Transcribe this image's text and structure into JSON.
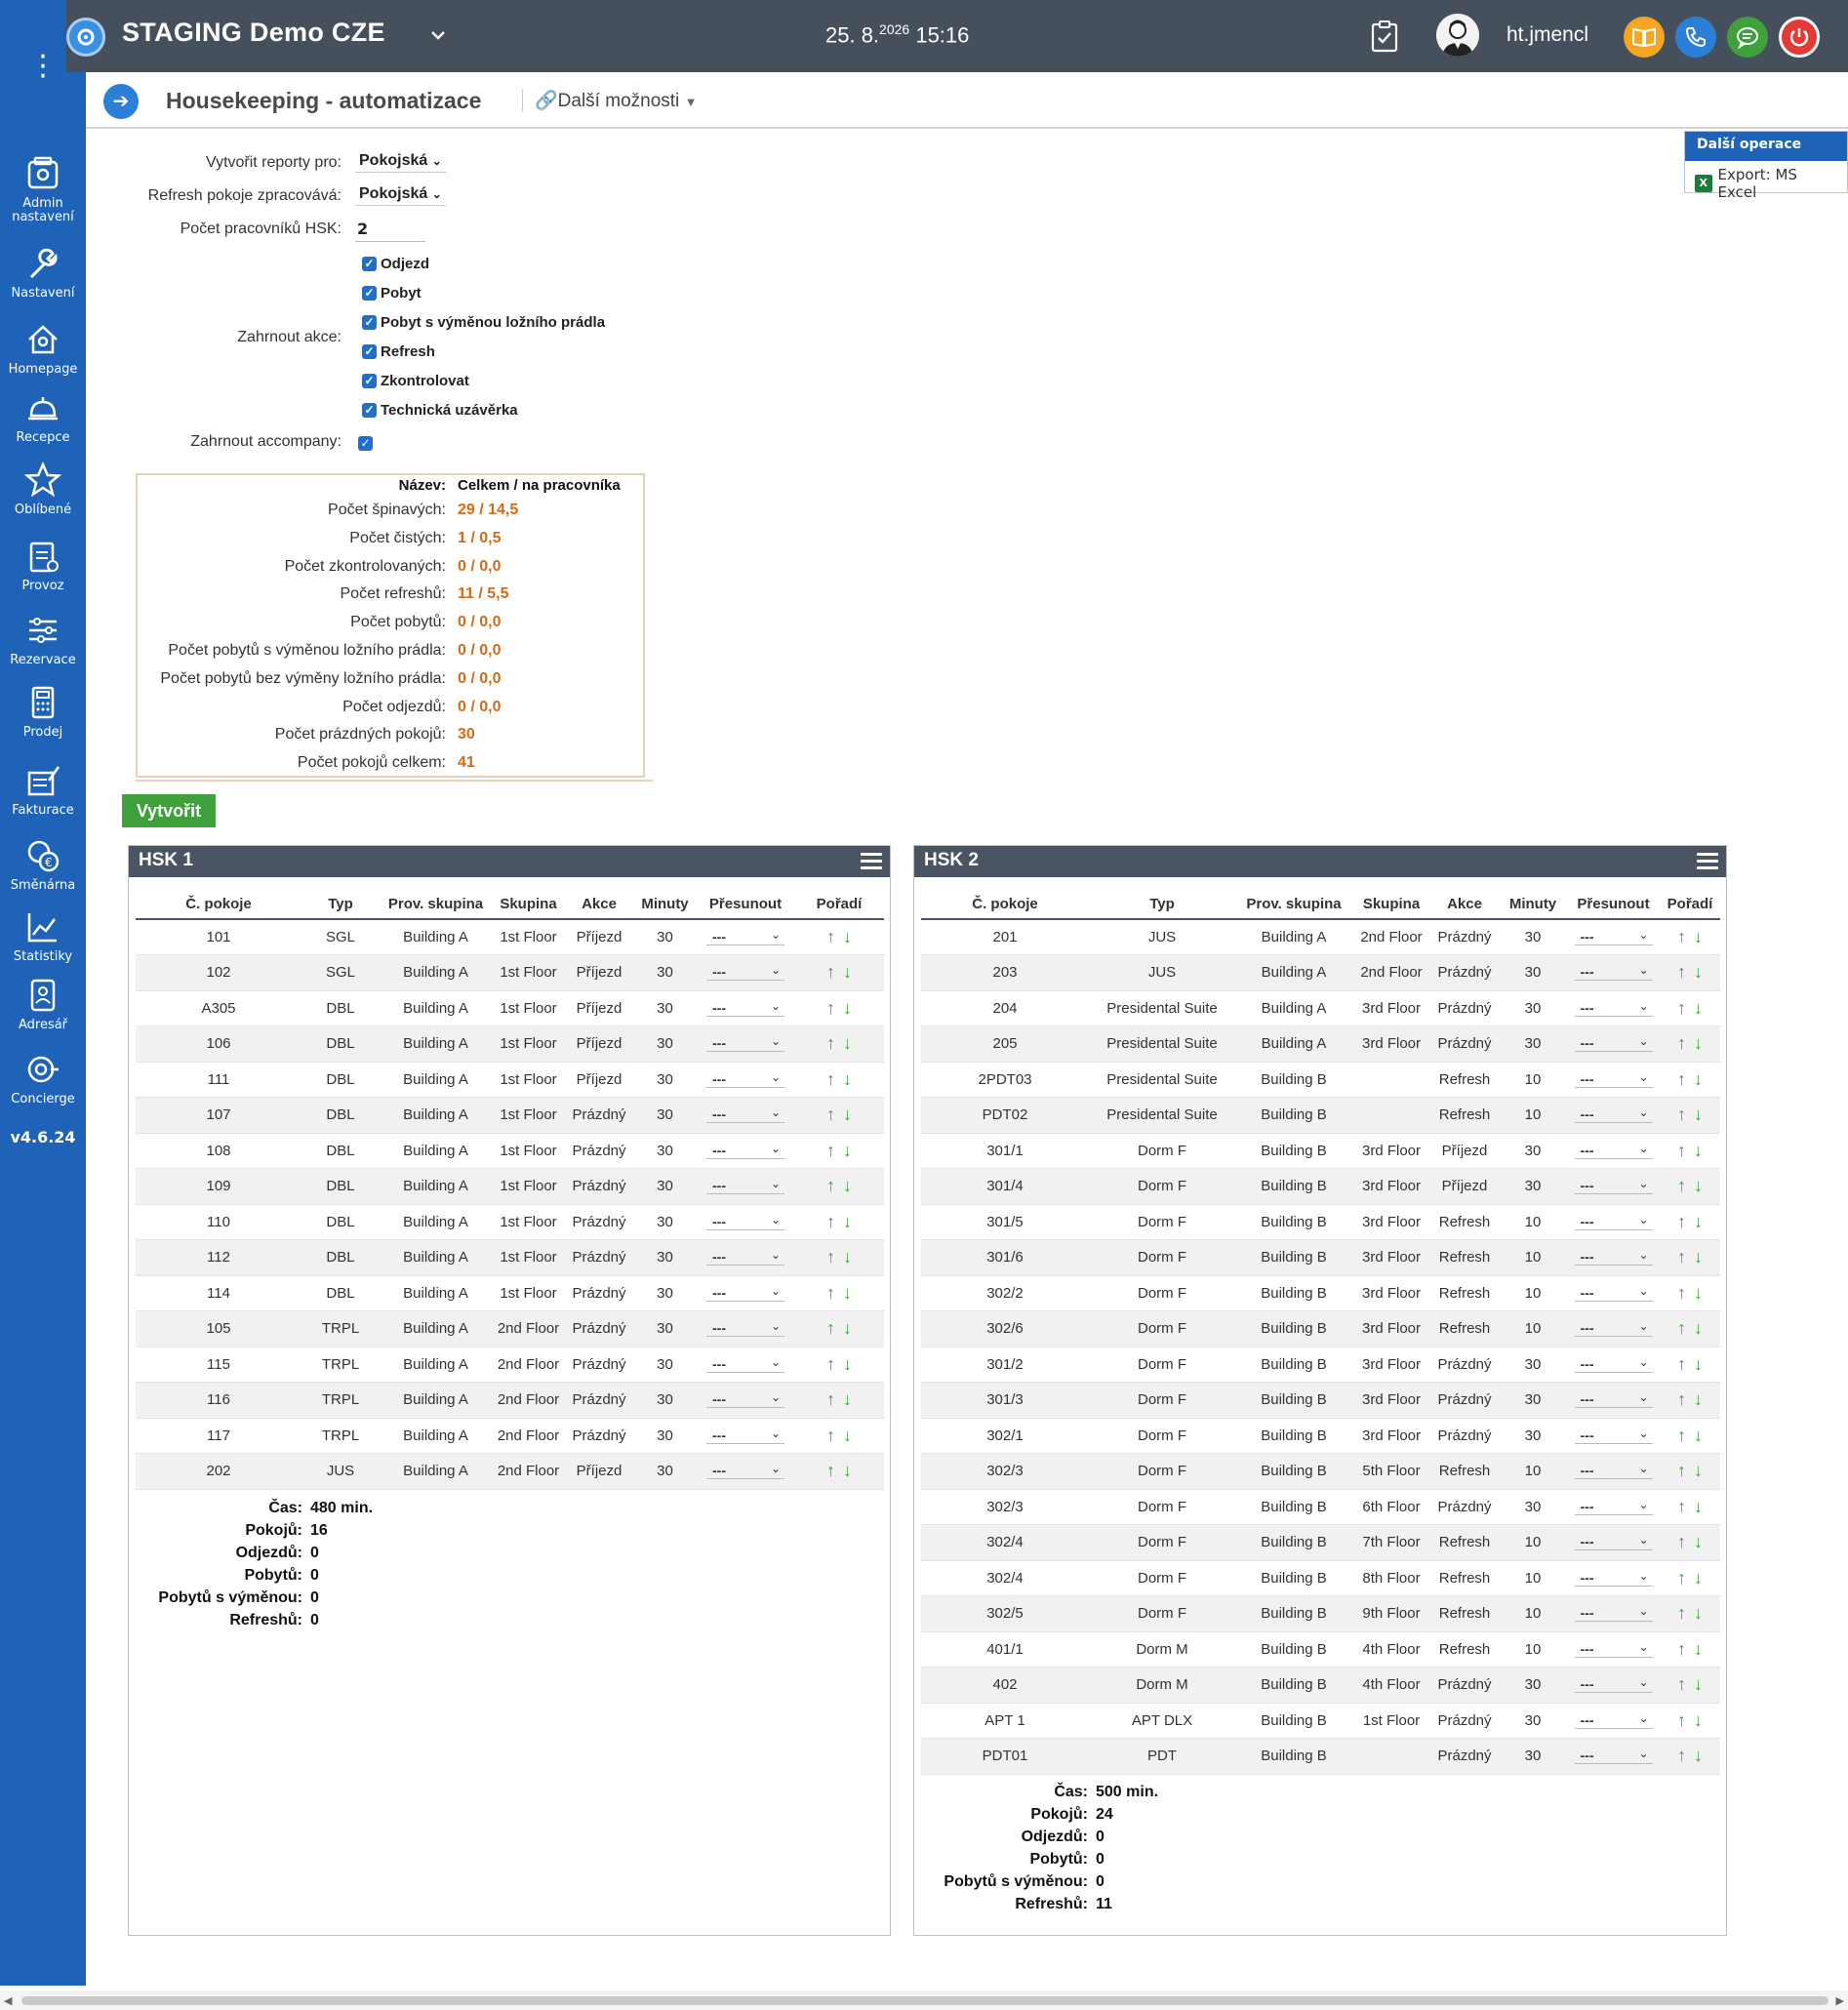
{
  "topbar": {
    "hotel": "STAGING Demo CZE",
    "date": "25. 8.",
    "year": "2026",
    "time": "15:16",
    "user": "ht.jmencl",
    "colors": {
      "book": "#f5a623",
      "phone": "#2c7fd6",
      "chat": "#3ea13c",
      "power": "#e53935"
    }
  },
  "sidebar": {
    "items": [
      {
        "label": "Admin",
        "label2": "nastavení",
        "icon": "gear-box-icon"
      },
      {
        "label": "Nastavení",
        "icon": "wrench-icon"
      },
      {
        "label": "Homepage",
        "icon": "home-icon"
      },
      {
        "label": "Recepce",
        "icon": "bell-icon"
      },
      {
        "label": "Oblíbené",
        "icon": "star-icon"
      },
      {
        "label": "Provoz",
        "icon": "clipboard-icon"
      },
      {
        "label": "Rezervace",
        "icon": "sliders-icon"
      },
      {
        "label": "Prodej",
        "icon": "calculator-icon"
      },
      {
        "label": "Fakturace",
        "icon": "invoice-icon"
      },
      {
        "label": "Směnárna",
        "icon": "coins-icon"
      },
      {
        "label": "Statistiky",
        "icon": "chart-icon"
      },
      {
        "label": "Adresář",
        "icon": "contacts-icon"
      },
      {
        "label": "Concierge",
        "icon": "concierge-icon"
      }
    ],
    "version": "v4.6.24"
  },
  "header": {
    "title": "Housekeeping - automatizace",
    "more": "Další možnosti"
  },
  "ops": {
    "title": "Další operace",
    "export": "Export: MS Excel"
  },
  "form": {
    "reports_label": "Vytvořit reporty pro:",
    "reports_value": "Pokojská",
    "refresh_label": "Refresh pokoje zpracovává:",
    "refresh_value": "Pokojská",
    "workers_label": "Počet pracovníků HSK:",
    "workers_value": "2",
    "actions_label": "Zahrnout akce:",
    "actions": [
      "Odjezd",
      "Pobyt",
      "Pobyt s výměnou ložního prádla",
      "Refresh",
      "Zkontrolovat",
      "Technická uzávěrka"
    ],
    "accompany_label": "Zahrnout accompany:"
  },
  "stats": {
    "head_label": "Název:",
    "head_value": "Celkem / na pracovníka",
    "rows": [
      {
        "label": "Počet špinavých:",
        "value": "29 / 14,5"
      },
      {
        "label": "Počet čistých:",
        "value": "1 / 0,5"
      },
      {
        "label": "Počet zkontrolovaných:",
        "value": "0 / 0,0"
      },
      {
        "label": "Počet refreshů:",
        "value": "11 / 5,5"
      },
      {
        "label": "Počet pobytů:",
        "value": "0 / 0,0"
      },
      {
        "label": "Počet pobytů s výměnou ložního prádla:",
        "value": "0 / 0,0"
      },
      {
        "label": "Počet pobytů bez výměny ložního prádla:",
        "value": "0 / 0,0"
      },
      {
        "label": "Počet odjezdů:",
        "value": "0 / 0,0"
      },
      {
        "label": "Počet prázdných pokojů:",
        "value": "30"
      },
      {
        "label": "Počet pokojů celkem:",
        "value": "41"
      }
    ]
  },
  "create_label": "Vytvořit",
  "columns": [
    "Č. pokoje",
    "Typ",
    "Prov. skupina",
    "Skupina",
    "Akce",
    "Minuty",
    "Přesunout",
    "Pořadí"
  ],
  "move_value": "---",
  "hsk1": {
    "title": "HSK 1",
    "rows": [
      [
        "101",
        "SGL",
        "Building A",
        "1st Floor",
        "Příjezd",
        "30"
      ],
      [
        "102",
        "SGL",
        "Building A",
        "1st Floor",
        "Příjezd",
        "30"
      ],
      [
        "A305",
        "DBL",
        "Building A",
        "1st Floor",
        "Příjezd",
        "30"
      ],
      [
        "106",
        "DBL",
        "Building A",
        "1st Floor",
        "Příjezd",
        "30"
      ],
      [
        "111",
        "DBL",
        "Building A",
        "1st Floor",
        "Příjezd",
        "30"
      ],
      [
        "107",
        "DBL",
        "Building A",
        "1st Floor",
        "Prázdný",
        "30"
      ],
      [
        "108",
        "DBL",
        "Building A",
        "1st Floor",
        "Prázdný",
        "30"
      ],
      [
        "109",
        "DBL",
        "Building A",
        "1st Floor",
        "Prázdný",
        "30"
      ],
      [
        "110",
        "DBL",
        "Building A",
        "1st Floor",
        "Prázdný",
        "30"
      ],
      [
        "112",
        "DBL",
        "Building A",
        "1st Floor",
        "Prázdný",
        "30"
      ],
      [
        "114",
        "DBL",
        "Building A",
        "1st Floor",
        "Prázdný",
        "30"
      ],
      [
        "105",
        "TRPL",
        "Building A",
        "2nd Floor",
        "Prázdný",
        "30"
      ],
      [
        "115",
        "TRPL",
        "Building A",
        "2nd Floor",
        "Prázdný",
        "30"
      ],
      [
        "116",
        "TRPL",
        "Building A",
        "2nd Floor",
        "Prázdný",
        "30"
      ],
      [
        "117",
        "TRPL",
        "Building A",
        "2nd Floor",
        "Prázdný",
        "30"
      ],
      [
        "202",
        "JUS",
        "Building A",
        "2nd Floor",
        "Příjezd",
        "30"
      ]
    ],
    "summary": [
      {
        "k": "Čas:",
        "v": "480 min."
      },
      {
        "k": "Pokojů:",
        "v": "16"
      },
      {
        "k": "Odjezdů:",
        "v": "0"
      },
      {
        "k": "Pobytů:",
        "v": "0"
      },
      {
        "k": "Pobytů s výměnou:",
        "v": "0"
      },
      {
        "k": "Refreshů:",
        "v": "0"
      }
    ]
  },
  "hsk2": {
    "title": "HSK 2",
    "rows": [
      [
        "201",
        "JUS",
        "Building A",
        "2nd Floor",
        "Prázdný",
        "30"
      ],
      [
        "203",
        "JUS",
        "Building A",
        "2nd Floor",
        "Prázdný",
        "30"
      ],
      [
        "204",
        "Presidental Suite",
        "Building A",
        "3rd Floor",
        "Prázdný",
        "30"
      ],
      [
        "205",
        "Presidental Suite",
        "Building A",
        "3rd Floor",
        "Prázdný",
        "30"
      ],
      [
        "2PDT03",
        "Presidental Suite",
        "Building B",
        "",
        "Refresh",
        "10"
      ],
      [
        "PDT02",
        "Presidental Suite",
        "Building B",
        "",
        "Refresh",
        "10"
      ],
      [
        "301/1",
        "Dorm F",
        "Building B",
        "3rd Floor",
        "Příjezd",
        "30"
      ],
      [
        "301/4",
        "Dorm F",
        "Building B",
        "3rd Floor",
        "Příjezd",
        "30"
      ],
      [
        "301/5",
        "Dorm F",
        "Building B",
        "3rd Floor",
        "Refresh",
        "10"
      ],
      [
        "301/6",
        "Dorm F",
        "Building B",
        "3rd Floor",
        "Refresh",
        "10"
      ],
      [
        "302/2",
        "Dorm F",
        "Building B",
        "3rd Floor",
        "Refresh",
        "10"
      ],
      [
        "302/6",
        "Dorm F",
        "Building B",
        "3rd Floor",
        "Refresh",
        "10"
      ],
      [
        "301/2",
        "Dorm F",
        "Building B",
        "3rd Floor",
        "Prázdný",
        "30"
      ],
      [
        "301/3",
        "Dorm F",
        "Building B",
        "3rd Floor",
        "Prázdný",
        "30"
      ],
      [
        "302/1",
        "Dorm F",
        "Building B",
        "3rd Floor",
        "Prázdný",
        "30"
      ],
      [
        "302/3",
        "Dorm F",
        "Building B",
        "5th Floor",
        "Refresh",
        "10"
      ],
      [
        "302/3",
        "Dorm F",
        "Building B",
        "6th Floor",
        "Prázdný",
        "30"
      ],
      [
        "302/4",
        "Dorm F",
        "Building B",
        "7th Floor",
        "Refresh",
        "10"
      ],
      [
        "302/4",
        "Dorm F",
        "Building B",
        "8th Floor",
        "Refresh",
        "10"
      ],
      [
        "302/5",
        "Dorm F",
        "Building B",
        "9th Floor",
        "Refresh",
        "10"
      ],
      [
        "401/1",
        "Dorm M",
        "Building B",
        "4th Floor",
        "Refresh",
        "10"
      ],
      [
        "402",
        "Dorm M",
        "Building B",
        "4th Floor",
        "Prázdný",
        "30"
      ],
      [
        "APT 1",
        "APT DLX",
        "Building B",
        "1st Floor",
        "Prázdný",
        "30"
      ],
      [
        "PDT01",
        "PDT",
        "Building B",
        "",
        "Prázdný",
        "30"
      ]
    ],
    "summary": [
      {
        "k": "Čas:",
        "v": "500 min."
      },
      {
        "k": "Pokojů:",
        "v": "24"
      },
      {
        "k": "Odjezdů:",
        "v": "0"
      },
      {
        "k": "Pobytů:",
        "v": "0"
      },
      {
        "k": "Pobytů s výměnou:",
        "v": "0"
      },
      {
        "k": "Refreshů:",
        "v": "11"
      }
    ]
  }
}
